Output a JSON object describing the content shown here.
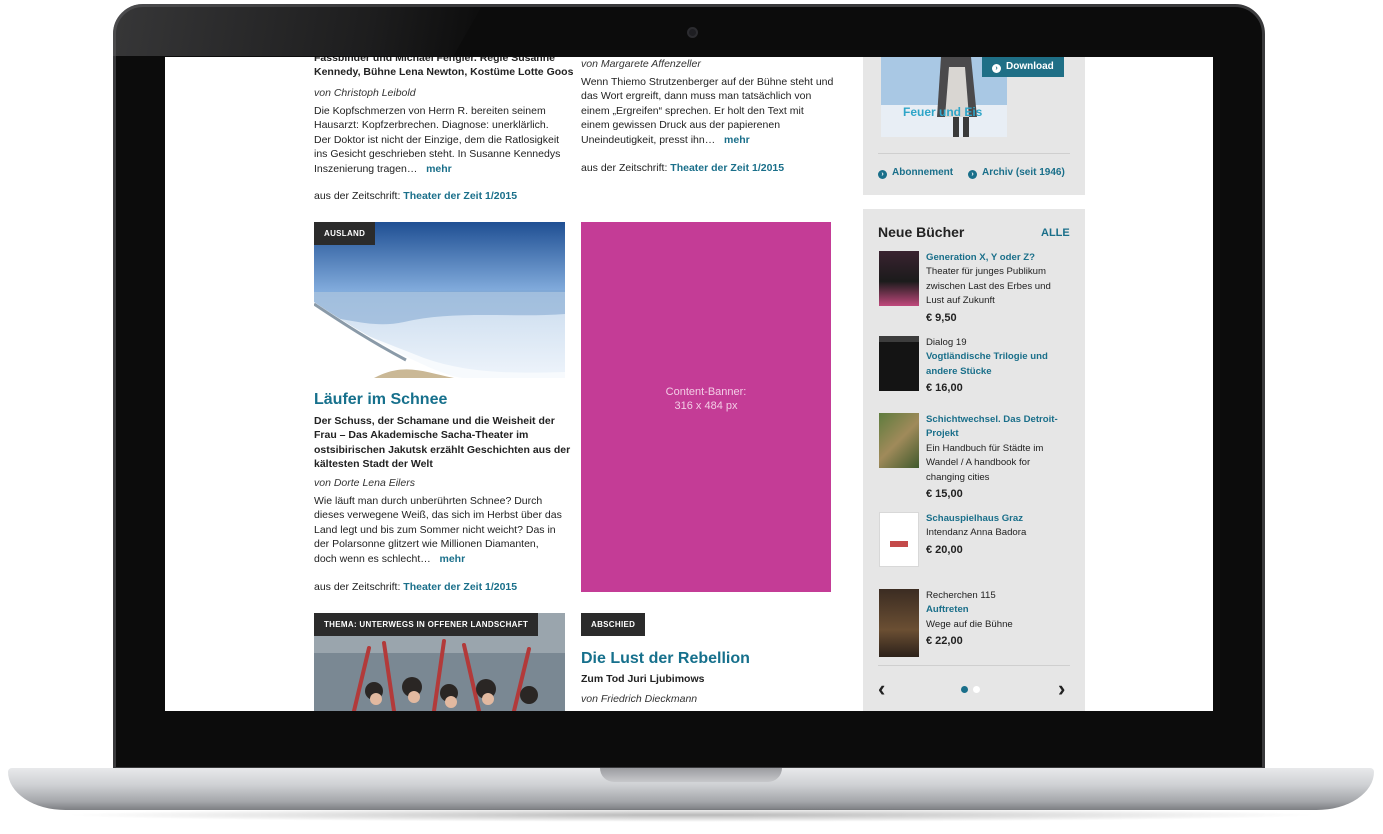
{
  "article_top_left": {
    "subtitle_line1": "Fassbinder und Michael Fengler. Regie Susanne",
    "subtitle_line2": "Kennedy, Bühne Lena Newton, Kostüme Lotte Goos",
    "author": "von Christoph Leibold",
    "body": [
      "Die Kopfschmerzen von Herrn R. bereiten seinem",
      "Hausarzt: Kopfzerbrechen. Diagnose: unerklärlich.",
      "Der Doktor ist nicht der Einzige, dem die Ratlosigkeit",
      "ins Gesicht geschrieben steht. In Susanne Kennedys",
      "Inszenierung tragen…"
    ],
    "more": "mehr",
    "source_prefix": "aus der Zeitschrift:",
    "source_link": "Theater der Zeit 1/2015"
  },
  "article_top_middle": {
    "author": "von Margarete Affenzeller",
    "body": [
      "Wenn Thiemo Strutzenberger auf der Bühne steht und",
      "das Wort ergreift, dann muss man tatsächlich von",
      "einem „Ergreifen“ sprechen. Er holt den Text mit",
      "einem gewissen Druck aus der papierenen",
      "Uneindeutigkeit, presst ihn…"
    ],
    "more": "mehr",
    "source_prefix": "aus der Zeitschrift:",
    "source_link": "Theater der Zeit 1/2015"
  },
  "article_ausland": {
    "tag": "AUSLAND",
    "title": "Läufer im Schnee",
    "subtitle": [
      "Der Schuss, der Schamane und die Weisheit der",
      "Frau – Das Akademische Sacha-Theater im",
      "ostsibirischen Jakutsk erzählt Geschichten aus der",
      "kältesten Stadt der Welt"
    ],
    "author": "von Dorte Lena Eilers",
    "body": [
      "Wie läuft man durch unberührten Schnee? Durch",
      "dieses verwegene Weiß, das sich im Herbst über das",
      "Land legt und bis zum Sommer nicht weicht? Das in",
      "der Polarsonne glitzert wie Millionen Diamanten,",
      "doch wenn es schlecht…"
    ],
    "more": "mehr",
    "source_prefix": "aus der Zeitschrift:",
    "source_link": "Theater der Zeit 1/2015"
  },
  "banner": {
    "line1": "Content-Banner:",
    "line2": "316 x 484 px"
  },
  "article_thema": {
    "tag": "THEMA: UNTERWEGS IN OFFENER LANDSCHAFT"
  },
  "article_abschied": {
    "tag": "ABSCHIED",
    "title": "Die Lust der Rebellion",
    "subtitle": "Zum Tod Juri Ljubimows",
    "author": "von Friedrich Dieckmann"
  },
  "magazine": {
    "cover_text": "Feuer und Eis",
    "download": "Download",
    "abo": "Abonnement",
    "archiv": "Archiv (seit 1946)"
  },
  "books": {
    "heading": "Neue Bücher",
    "all": "ALLE",
    "items": [
      {
        "title": "Generation X, Y oder Z?",
        "desc": [
          "Theater für junges Publikum",
          "zwischen Last des Erbes und",
          "Lust auf Zukunft"
        ],
        "price": "€ 9,50"
      },
      {
        "series": "Dialog 19",
        "title_lines": [
          "Vogtländische Trilogie und",
          "andere Stücke"
        ],
        "price": "€ 16,00"
      },
      {
        "title_lines": [
          "Schichtwechsel. Das Detroit-",
          "Projekt"
        ],
        "desc": [
          "Ein Handbuch für Städte im",
          "Wandel / A handbook for",
          "changing cities"
        ],
        "price": "€ 15,00"
      },
      {
        "title": "Schauspielhaus Graz",
        "desc": [
          "Intendanz Anna Badora"
        ],
        "price": "€ 20,00"
      },
      {
        "series": "Recherchen 115",
        "title": "Auftreten",
        "desc": [
          "Wege auf die Bühne"
        ],
        "price": "€ 22,00"
      }
    ],
    "prev": "‹",
    "next": "›"
  }
}
